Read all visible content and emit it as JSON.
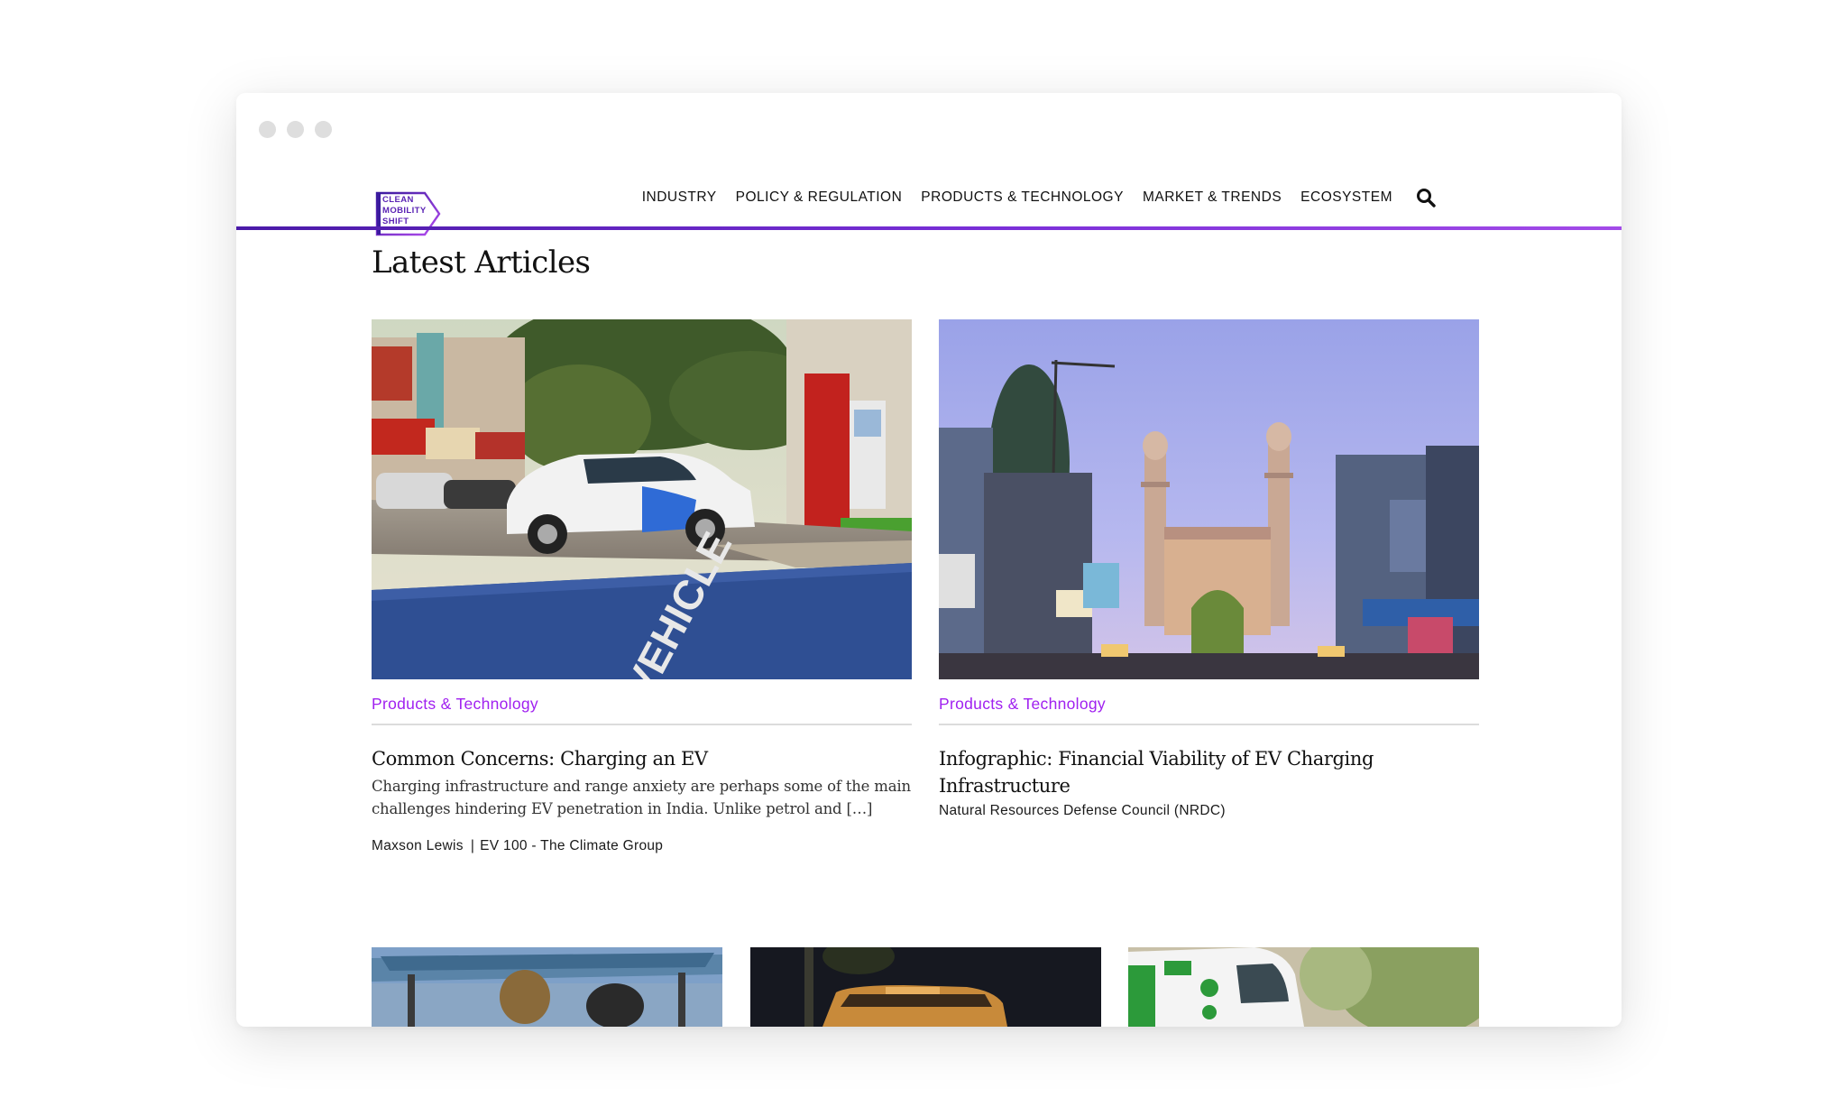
{
  "brand": {
    "logo_lines": [
      "CLEAN",
      "MOBILITY",
      "SHIFT"
    ],
    "accent_color": "#a020f0",
    "rule_color": "#5a23b4"
  },
  "nav": {
    "items": [
      "INDUSTRY",
      "POLICY & REGULATION",
      "PRODUCTS & TECHNOLOGY",
      "MARKET & TRENDS",
      "ECOSYSTEM"
    ],
    "search_icon": "search-icon"
  },
  "page": {
    "title": "Latest Articles"
  },
  "articles": [
    {
      "category": "Products & Technology",
      "title": "Common Concerns: Charging an EV",
      "excerpt": "Charging infrastructure and range anxiety are perhaps some of the main challenges hindering EV penetration in India. Unlike petrol and […]",
      "author": "Maxson Lewis",
      "separator": "|",
      "source": "EV 100 - The Climate Group",
      "image": "ev-charging-car-photo"
    },
    {
      "category": "Products & Technology",
      "title": "Infographic: Financial Viability of EV Charging Infrastructure",
      "source": "Natural Resources Defense Council (NRDC)",
      "image": "charminar-street-photo"
    }
  ],
  "thumbnails": [
    "rickshaw-photo",
    "bus-night-photo",
    "electric-bus-photo"
  ]
}
